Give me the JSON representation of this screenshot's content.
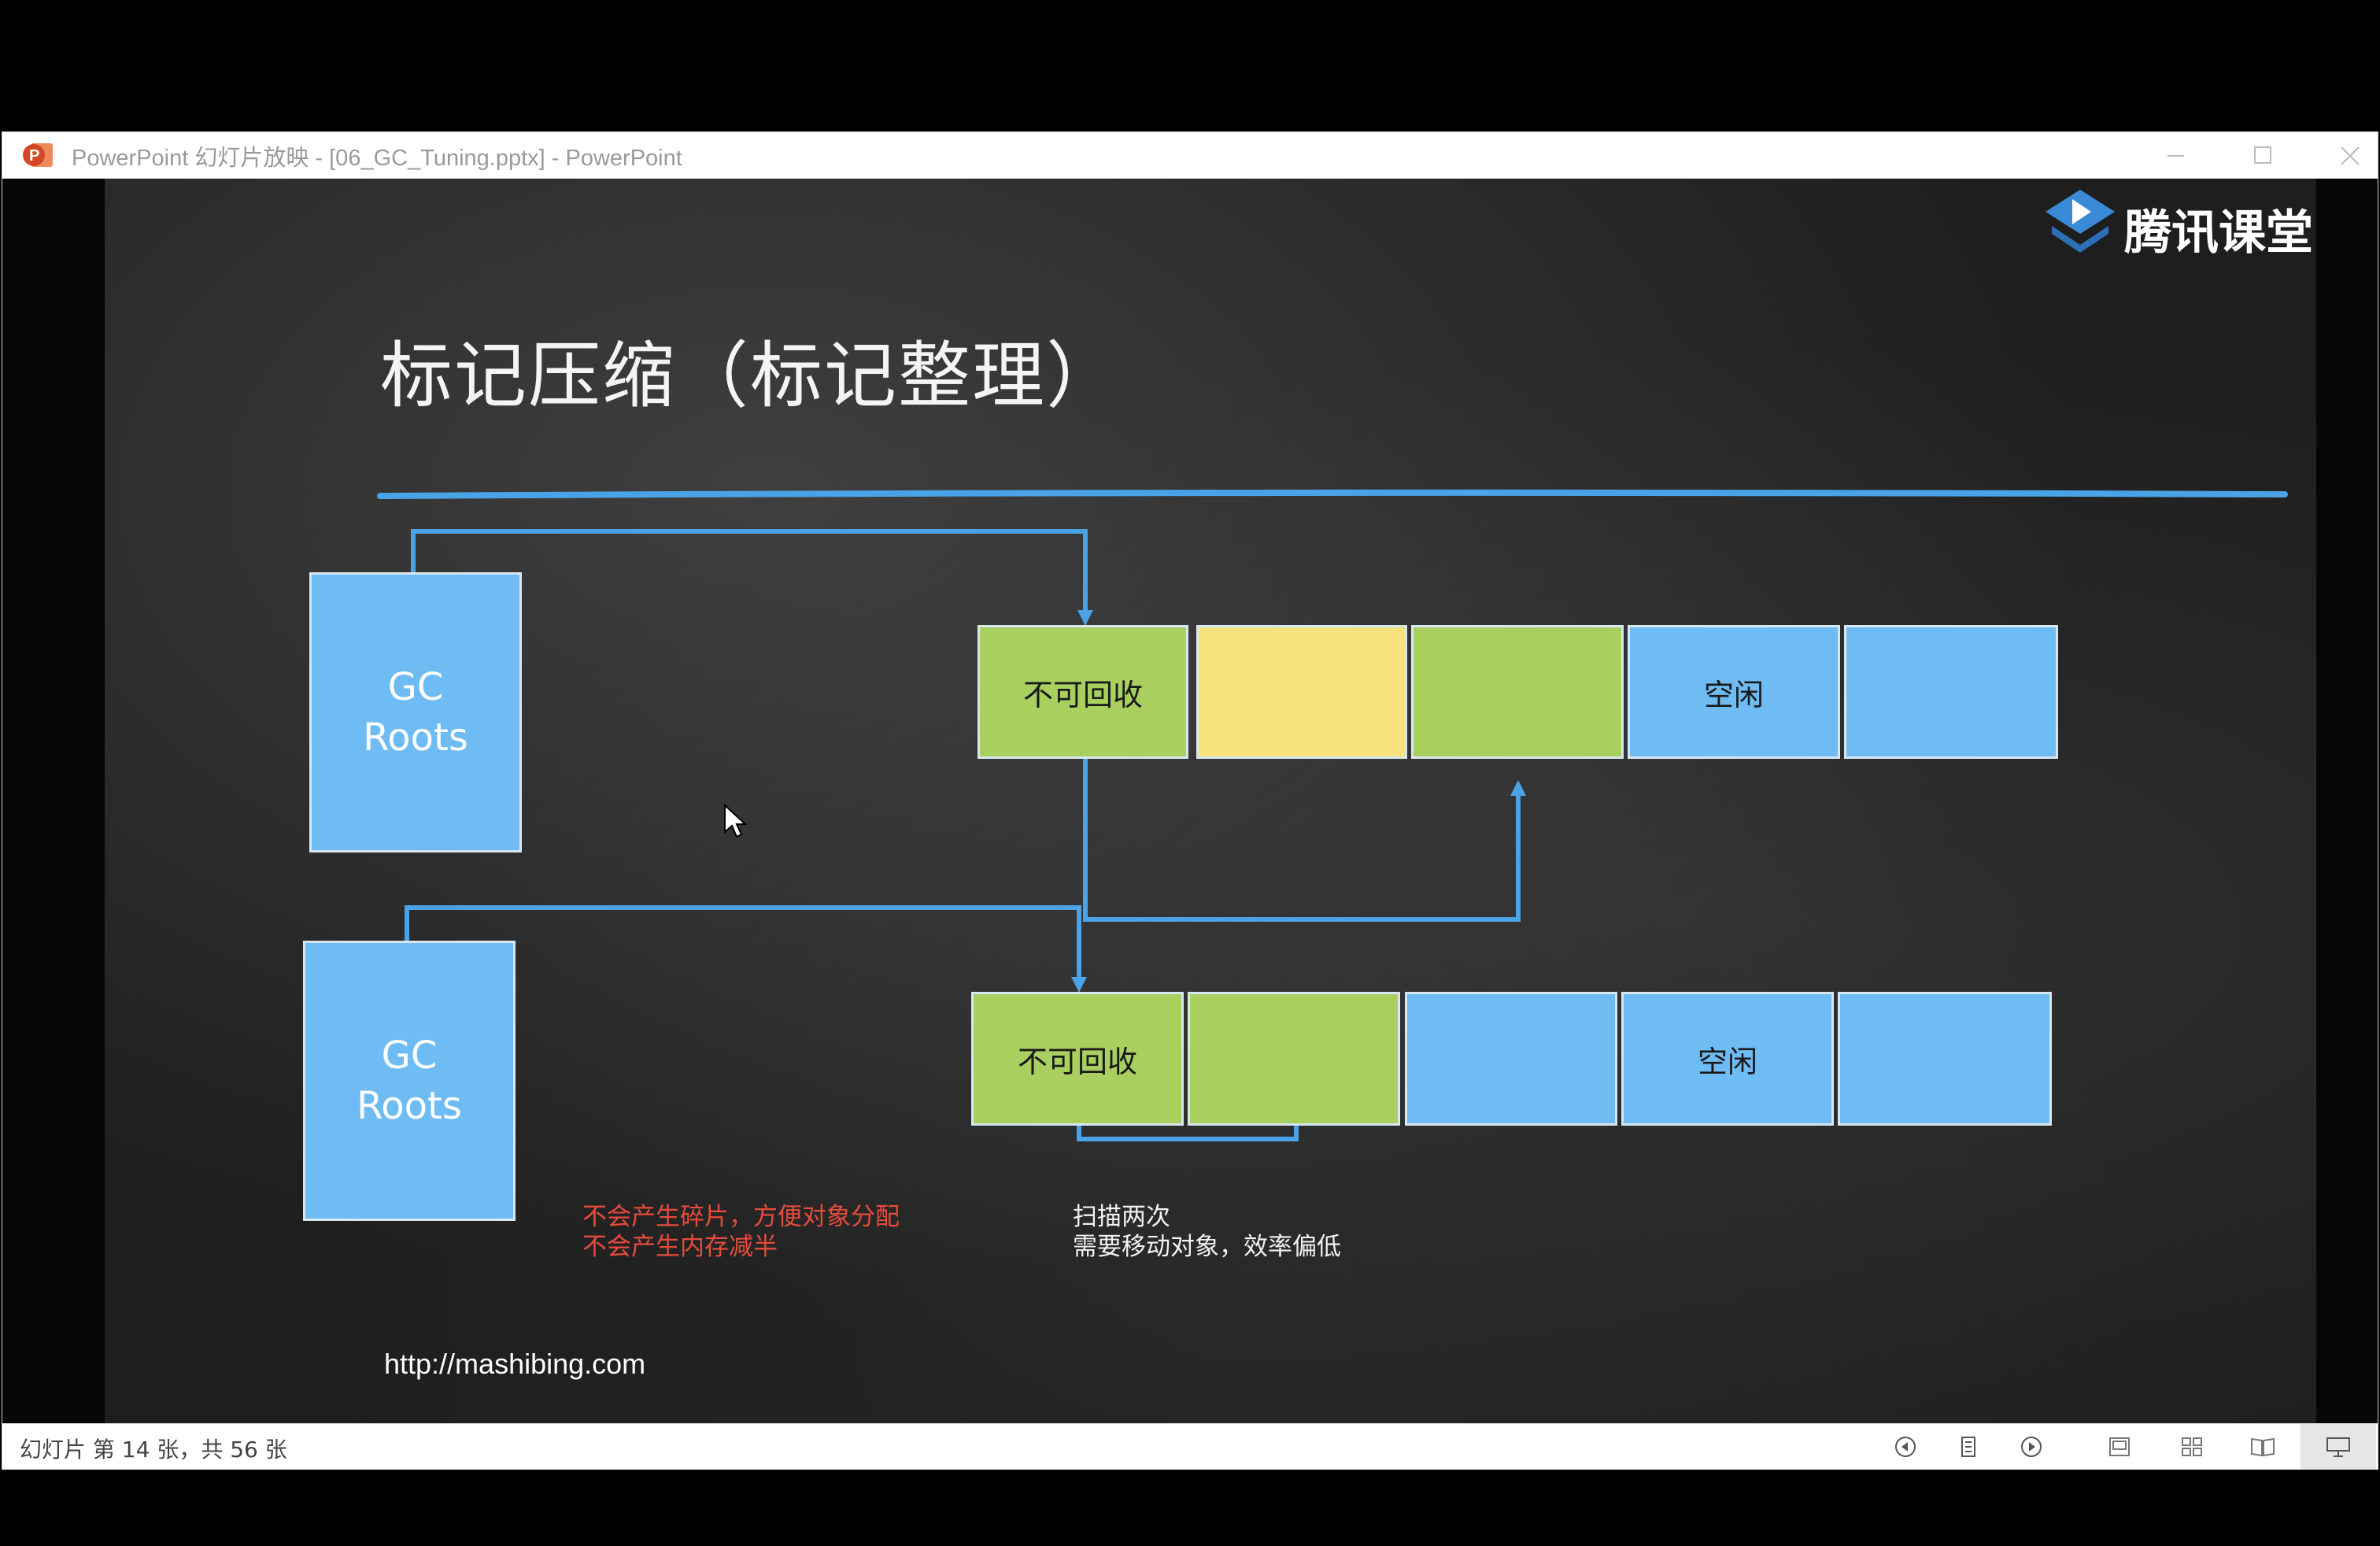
{
  "window": {
    "title": "PowerPoint 幻灯片放映 - [06_GC_Tuning.pptx] - PowerPoint",
    "icons": {
      "app": "powerpoint-icon",
      "minimize": "minimize-icon",
      "maximize": "maximize-icon",
      "close": "close-icon"
    }
  },
  "slide": {
    "logo_text": "腾讯课堂",
    "title": "标记压缩（标记整理）",
    "top_diagram": {
      "gc_roots_label": [
        "GC",
        "Roots"
      ],
      "cells": [
        {
          "label": "不可回收",
          "color": "#a9d05e"
        },
        {
          "label": "",
          "color": "#f8e27d"
        },
        {
          "label": "",
          "color": "#a9d05e"
        },
        {
          "label": "空闲",
          "color": "#6fbcf4"
        },
        {
          "label": "",
          "color": "#6fbcf4"
        }
      ]
    },
    "bottom_diagram": {
      "gc_roots_label": [
        "GC",
        "Roots"
      ],
      "cells": [
        {
          "label": "不可回收",
          "color": "#a9d05e"
        },
        {
          "label": "",
          "color": "#a9d05e"
        },
        {
          "label": "",
          "color": "#6fbcf4"
        },
        {
          "label": "空闲",
          "color": "#6fbcf4"
        },
        {
          "label": "",
          "color": "#6fbcf4"
        }
      ]
    },
    "pros": [
      "不会产生碎片，方便对象分配",
      "不会产生内存减半"
    ],
    "cons": [
      "扫描两次",
      "需要移动对象，效率偏低"
    ],
    "url": "http://mashibing.com",
    "colors": {
      "line": "#4aa3e6",
      "pros_text": "#e74b3b"
    }
  },
  "statusbar": {
    "slide_info": "幻灯片 第 14 张，共 56 张",
    "icons": [
      "previous-icon",
      "menu-icon",
      "next-icon",
      "normal-view-icon",
      "slide-sorter-icon",
      "reading-view-icon",
      "slideshow-icon"
    ]
  }
}
